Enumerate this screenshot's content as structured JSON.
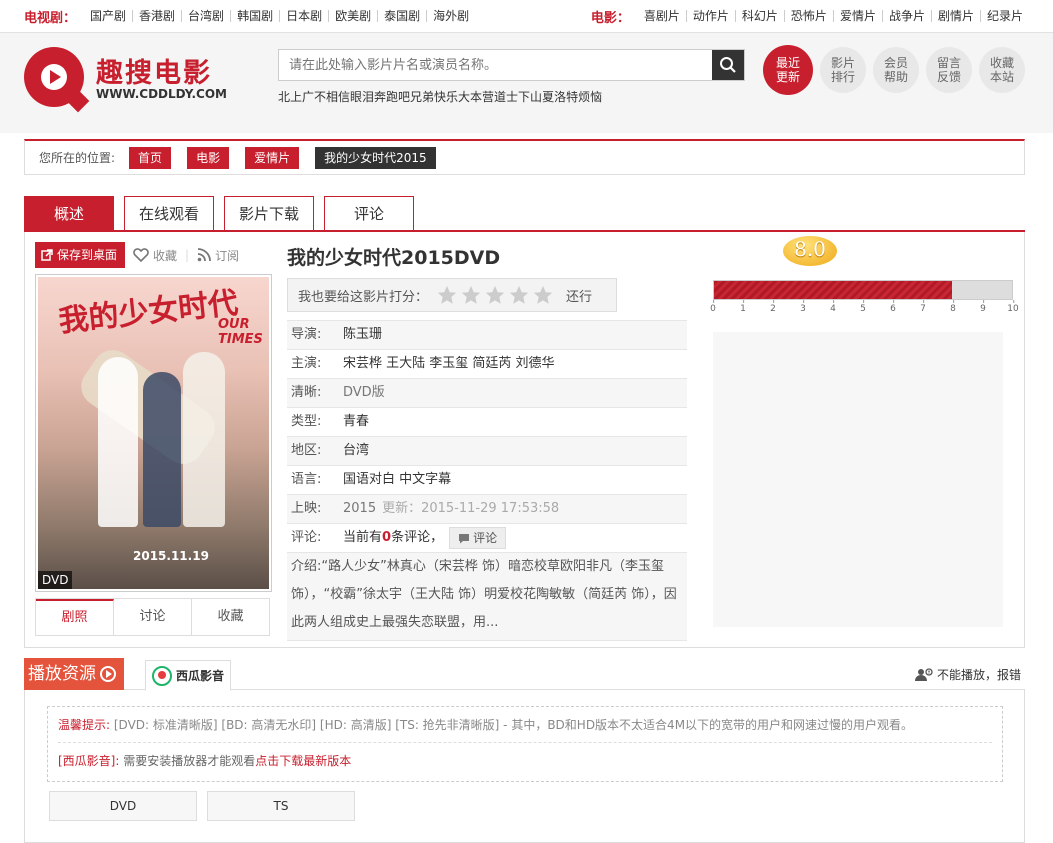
{
  "topnav": {
    "tv_label": "电视剧：",
    "tv_items": [
      "国产剧",
      "香港剧",
      "台湾剧",
      "韩国剧",
      "日本剧",
      "欧美剧",
      "泰国剧",
      "海外剧"
    ],
    "movie_label": "电影：",
    "movie_items": [
      "喜剧片",
      "动作片",
      "科幻片",
      "恐怖片",
      "爱情片",
      "战争片",
      "剧情片",
      "纪录片"
    ]
  },
  "header": {
    "logo_name": "趣搜电影",
    "logo_url": "WWW.CDDLDY.COM",
    "search_placeholder": "请在此处输入影片片名或演员名称。",
    "hotwords": [
      "北上广不相信眼泪",
      "奔跑吧兄弟",
      "快乐大本营",
      "道士下山",
      "夏洛特烦恼"
    ],
    "quick_links": [
      {
        "label": "最近更新",
        "active": true
      },
      {
        "label": "影片排行",
        "active": false
      },
      {
        "label": "会员帮助",
        "active": false
      },
      {
        "label": "留言反馈",
        "active": false
      },
      {
        "label": "收藏本站",
        "active": false
      }
    ]
  },
  "breadcrumb": {
    "label": "您所在的位置:",
    "items": [
      "首页",
      "电影",
      "爱情片",
      "我的少女时代2015"
    ]
  },
  "tabs": [
    "概述",
    "在线观看",
    "影片下载",
    "评论"
  ],
  "poster": {
    "save_label": "保存到桌面",
    "collect_label": "收藏",
    "subscribe_label": "订阅",
    "poster_title": "我的少女时代",
    "poster_sub": "OUR TIMES",
    "poster_date": "2015.11.19",
    "quality_tag": "DVD",
    "tabs": [
      "剧照",
      "讨论",
      "收藏"
    ]
  },
  "movie": {
    "title": "我的少女时代2015DVD",
    "rate_label": "我也要给这影片打分：",
    "rate_back": "还行",
    "fields": {
      "director_k": "导演:",
      "director_v": "陈玉珊",
      "cast_k": "主演:",
      "cast_v": "宋芸桦 王大陆 李玉玺 简廷芮 刘德华",
      "quality_k": "清晰:",
      "quality_v": "DVD版",
      "genre_k": "类型:",
      "genre_v": "青春",
      "region_k": "地区:",
      "region_v": "台湾",
      "lang_k": "语言:",
      "lang_v": "国语对白 中文字幕",
      "release_k": "上映:",
      "release_v": "2015",
      "update_v": "更新：2015-11-29 17:53:58",
      "comment_k": "评论:",
      "comment_pre": "当前有",
      "comment_count": "0",
      "comment_post": "条评论，",
      "comment_btn": "评论"
    },
    "intro_k": "介绍:",
    "intro": "“路人少女”林真心（宋芸桦 饰）暗恋校草欧阳非凡（李玉玺 饰），“校霸”徐太宇（王大陆 饰）明爱校花陶敏敏（简廷芮 饰），因此两人组成史上最强失恋联盟，用..."
  },
  "score": {
    "value": 8.0,
    "value_text": "8.0",
    "max": 10,
    "ticks": [
      "0",
      "1",
      "2",
      "3",
      "4",
      "5",
      "6",
      "7",
      "8",
      "9",
      "10"
    ],
    "bar_color": "#c81f2e"
  },
  "play": {
    "label": "播放资源",
    "source_tab": "西瓜影音",
    "report": "不能播放，报错",
    "tip1_label": "温馨提示:",
    "tip1_text": "[DVD: 标准清晰版] [BD: 高清无水印] [HD: 高清版] [TS: 抢先非清晰版] - 其中，BD和HD版本不太适合4M以下的宽带的用户和网速过慢的用户观看。",
    "tip2_label": "[西瓜影音]:",
    "tip2_text": "需要安装播放器才能观看",
    "tip2_link": "点击下载最新版本",
    "sources": [
      "DVD",
      "TS"
    ]
  },
  "colors": {
    "accent": "#c81f2e",
    "dark": "#333333",
    "orange": "#e4533b"
  }
}
